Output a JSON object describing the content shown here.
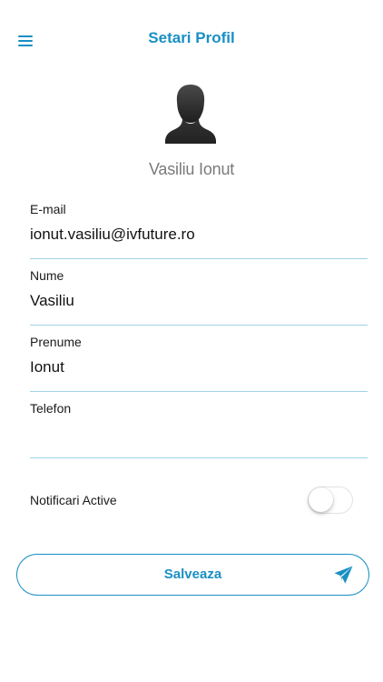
{
  "header": {
    "title": "Setari Profil",
    "menu_icon": "hamburger-menu-icon"
  },
  "profile": {
    "avatar_icon": "user-silhouette-icon",
    "name": "Vasiliu Ionut"
  },
  "fields": [
    {
      "label": "E-mail",
      "value": "ionut.vasiliu@ivfuture.ro",
      "placeholder": ""
    },
    {
      "label": "Nume",
      "value": "Vasiliu",
      "placeholder": ""
    },
    {
      "label": "Prenume",
      "value": "Ionut",
      "placeholder": ""
    },
    {
      "label": "Telefon",
      "value": "",
      "placeholder": ""
    }
  ],
  "notifications": {
    "label": "Notificari Active",
    "enabled": false
  },
  "save_button": {
    "label": "Salveaza",
    "icon": "paper-plane-send-icon"
  },
  "colors": {
    "accent": "#1a8fc4",
    "divider": "#9fd2e8",
    "muted_text": "#7a7a7a"
  }
}
